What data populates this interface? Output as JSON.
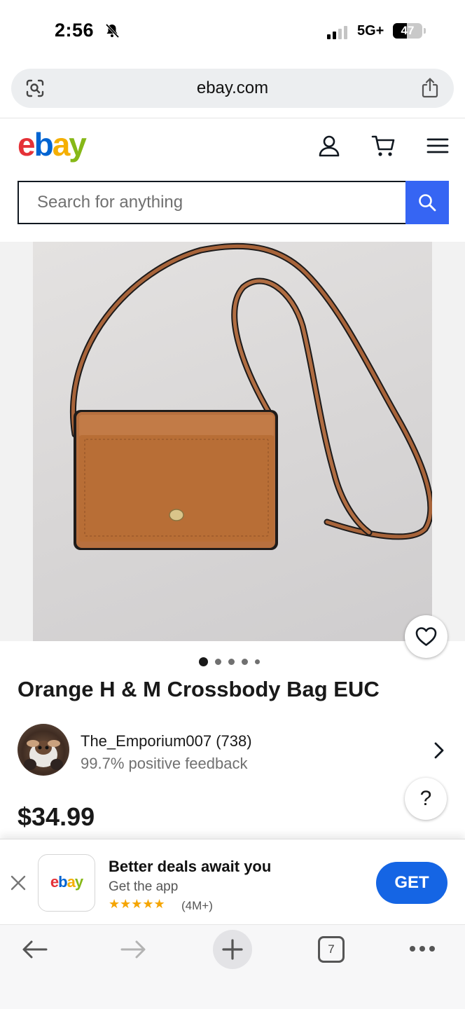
{
  "status_bar": {
    "time": "2:56",
    "network": "5G+",
    "battery": "47"
  },
  "browser": {
    "url": "ebay.com",
    "tab_count": "7"
  },
  "header": {
    "logo_letters": [
      "e",
      "b",
      "a",
      "y"
    ],
    "account_icon": "person-icon",
    "cart_icon": "cart-icon",
    "menu_icon": "hamburger-menu-icon"
  },
  "search": {
    "placeholder": "Search for anything",
    "button_icon": "search-icon"
  },
  "product": {
    "title": "Orange H & M Crossbody Bag EUC",
    "price": "$34.99",
    "image_count": 5,
    "active_image": 1
  },
  "seller": {
    "name": "The_Emporium007 (738)",
    "feedback": "99.7% positive feedback"
  },
  "help": {
    "label": "?"
  },
  "app_banner": {
    "tile_letters": [
      "e",
      "b",
      "a",
      "y"
    ],
    "title": "Better deals await you",
    "subtitle": "Get the app",
    "stars": "★★★★★",
    "rating_count": "(4M+)",
    "button": "GET"
  },
  "colors": {
    "ebay_red": "#e53238",
    "ebay_blue": "#0064d2",
    "ebay_yellow": "#f5af02",
    "ebay_green": "#86b817",
    "search_button": "#3665f3",
    "get_button": "#1565e4"
  }
}
